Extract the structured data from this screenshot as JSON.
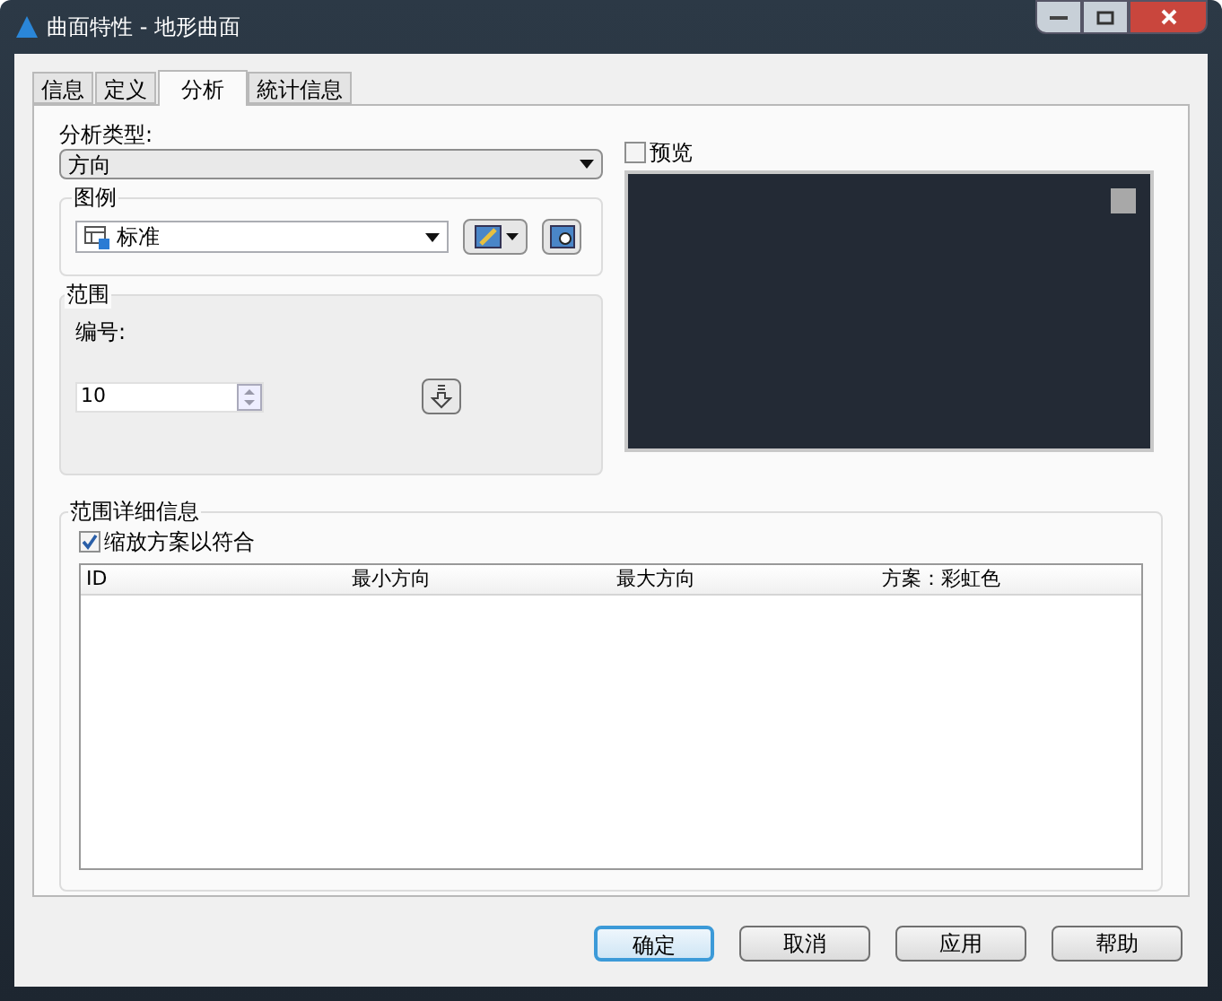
{
  "window": {
    "title": "曲面特性 - 地形曲面"
  },
  "tabs": [
    {
      "label": "信息",
      "selected": false
    },
    {
      "label": "定义",
      "selected": false
    },
    {
      "label": "分析",
      "selected": true
    },
    {
      "label": "統计信息",
      "selected": false
    }
  ],
  "analysis_type": {
    "label": "分析类型:",
    "value": "方向"
  },
  "legend": {
    "label": "图例",
    "value": "标准"
  },
  "range": {
    "label": "范围",
    "number_label": "编号:",
    "number_value": "10"
  },
  "preview": {
    "label": "预览",
    "checked": false
  },
  "range_details": {
    "label": "范围详细信息",
    "scale_to_fit": {
      "label": "缩放方案以符合",
      "checked": true
    },
    "table": {
      "columns": [
        "ID",
        "最小方向",
        "最大方向",
        "方案：彩虹色"
      ]
    }
  },
  "buttons": [
    {
      "label": "确定",
      "default": true
    },
    {
      "label": "取消",
      "default": false
    },
    {
      "label": "应用",
      "default": false
    },
    {
      "label": "帮助",
      "default": false
    }
  ]
}
